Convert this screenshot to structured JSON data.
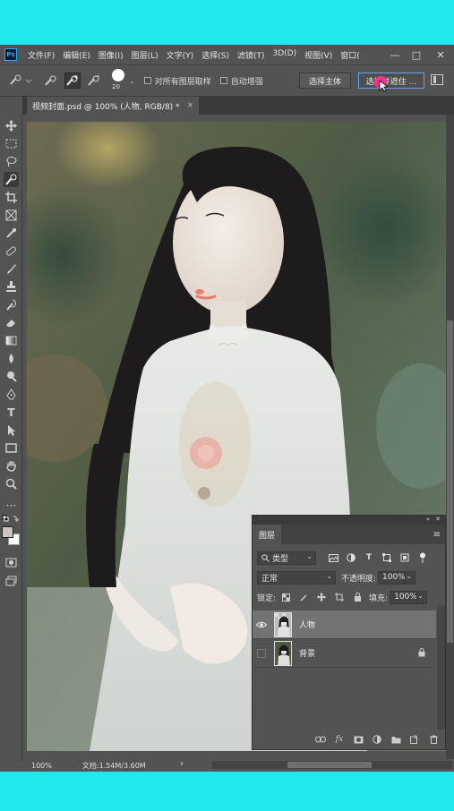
{
  "menubar": {
    "logo": "Ps",
    "items": [
      "文件(F)",
      "编辑(E)",
      "图像(I)",
      "图层(L)",
      "文字(Y)",
      "选择(S)",
      "滤镜(T)",
      "3D(D)",
      "视图(V)",
      "窗口("
    ],
    "minimize": "—",
    "maximize": "□",
    "close": "✕"
  },
  "options": {
    "brush_size": "20",
    "sample_all_layers": "对所有图层取样",
    "auto_enhance": "自动增强",
    "select_subject": "选择主体",
    "select_and_mask": "选择并遮住 ..."
  },
  "document": {
    "tab_title": "视频封面.psd @ 100% (人物, RGB/8) *",
    "close": "×"
  },
  "status": {
    "zoom": "100%",
    "doc_info": "文档:1.54M/3.60M",
    "arrow": "›"
  },
  "layers_panel": {
    "collapse": "«",
    "close": "✕",
    "tab": "图层",
    "menu": "≡",
    "filter_kind": "类型",
    "blend_mode": "正常",
    "opacity_label": "不透明度:",
    "opacity_value": "100%",
    "lock_label": "锁定:",
    "fill_label": "填充:",
    "fill_value": "100%",
    "layers": [
      {
        "name": "人物",
        "visible": true,
        "selected": true,
        "locked": false
      },
      {
        "name": "背景",
        "visible": false,
        "selected": false,
        "locked": true
      }
    ]
  },
  "colors": {
    "app_bg": "#535353",
    "dark_bg": "#3a3a3a",
    "accent": "#5fa6f5",
    "frame": "#20e8ee",
    "cursor_highlight": "#ff2e8a"
  }
}
